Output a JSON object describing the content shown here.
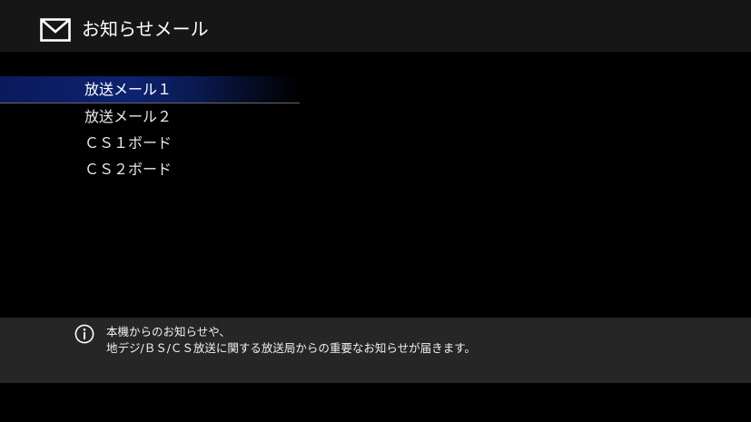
{
  "header": {
    "icon": "mail-icon",
    "title": "お知らせメール"
  },
  "menu": {
    "items": [
      {
        "label": "放送メール１",
        "selected": true
      },
      {
        "label": "放送メール２",
        "selected": false
      },
      {
        "label": "ＣＳ１ボード",
        "selected": false
      },
      {
        "label": "ＣＳ２ボード",
        "selected": false
      }
    ]
  },
  "info": {
    "icon": "info-icon",
    "line1": "本機からのお知らせや、",
    "line2": "地デジ/ＢＳ/ＣＳ放送に関する放送局からの重要なお知らせが届きます。"
  },
  "colors": {
    "background": "#000000",
    "header_bg": "#161616",
    "info_bg": "#262626",
    "selection": "#0d2270"
  }
}
